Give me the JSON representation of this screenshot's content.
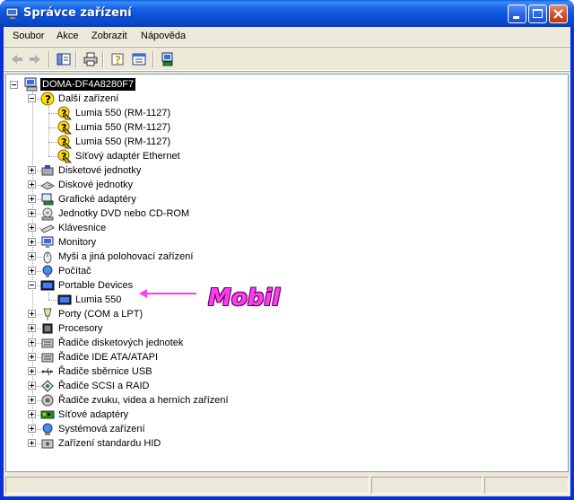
{
  "window": {
    "title": "Správce zařízení",
    "icon": "computer-manager-icon"
  },
  "menu": [
    "Soubor",
    "Akce",
    "Zobrazit",
    "Nápověda"
  ],
  "toolbar": {
    "icons": [
      "back-arrow-icon",
      "forward-arrow-icon",
      "show-hide-tree-icon",
      "print-icon",
      "help-icon",
      "properties-icon",
      "scan-hardware-icon"
    ]
  },
  "tree": {
    "root": "DOMA-DF4A8280F7",
    "other_devices": {
      "label": "Další zařízení",
      "children": [
        "Lumia 550 (RM-1127)",
        "Lumia 550 (RM-1127)",
        "Lumia 550 (RM-1127)",
        "Síťový adaptér Ethernet"
      ]
    },
    "categories_a": [
      "Disketové jednotky",
      "Diskové jednotky",
      "Grafické adaptéry",
      "Jednotky DVD nebo CD-ROM",
      "Klávesnice",
      "Monitory",
      "Myši a jiná polohovací zařízení",
      "Počítač"
    ],
    "portable": {
      "label": "Portable Devices",
      "child": "Lumia 550"
    },
    "categories_b": [
      "Porty (COM a LPT)",
      "Procesory",
      "Řadiče disketových jednotek",
      "Řadiče IDE ATA/ATAPI",
      "Řadiče sběrnice USB",
      "Řadiče SCSI a RAID",
      "Řadiče zvuku, videa a herních zařízení",
      "Síťové adaptéry",
      "Systémová zařízení",
      "Zařízení standardu HID"
    ]
  },
  "annotation": {
    "text": "Mobil",
    "color": "#ff3df0"
  },
  "colors": {
    "titlebar": "#0a52d8",
    "selection": "#000000",
    "face": "#ece9d8",
    "warning": "#ffe000"
  }
}
